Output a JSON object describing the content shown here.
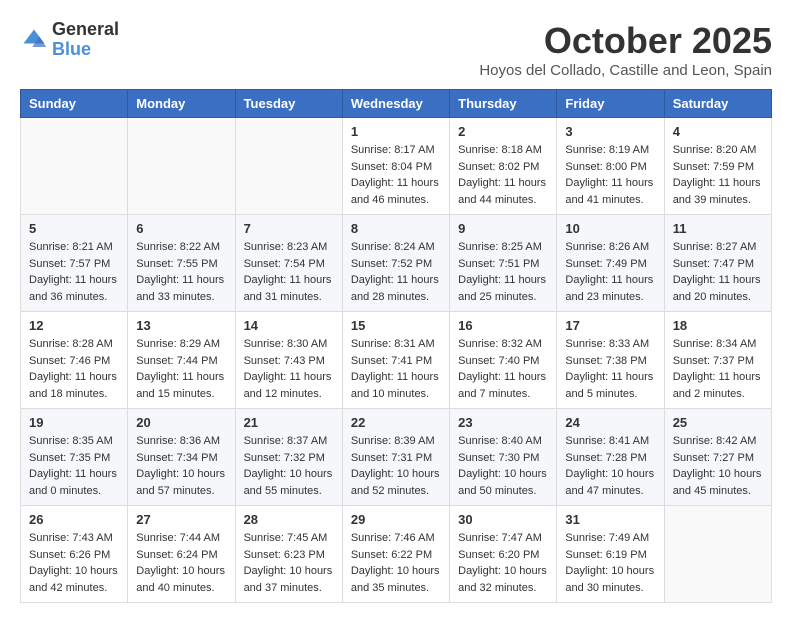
{
  "header": {
    "logo_general": "General",
    "logo_blue": "Blue",
    "month_title": "October 2025",
    "location": "Hoyos del Collado, Castille and Leon, Spain"
  },
  "days_of_week": [
    "Sunday",
    "Monday",
    "Tuesday",
    "Wednesday",
    "Thursday",
    "Friday",
    "Saturday"
  ],
  "weeks": [
    [
      {
        "day": "",
        "sunrise": "",
        "sunset": "",
        "daylight": ""
      },
      {
        "day": "",
        "sunrise": "",
        "sunset": "",
        "daylight": ""
      },
      {
        "day": "",
        "sunrise": "",
        "sunset": "",
        "daylight": ""
      },
      {
        "day": "1",
        "sunrise": "Sunrise: 8:17 AM",
        "sunset": "Sunset: 8:04 PM",
        "daylight": "Daylight: 11 hours and 46 minutes."
      },
      {
        "day": "2",
        "sunrise": "Sunrise: 8:18 AM",
        "sunset": "Sunset: 8:02 PM",
        "daylight": "Daylight: 11 hours and 44 minutes."
      },
      {
        "day": "3",
        "sunrise": "Sunrise: 8:19 AM",
        "sunset": "Sunset: 8:00 PM",
        "daylight": "Daylight: 11 hours and 41 minutes."
      },
      {
        "day": "4",
        "sunrise": "Sunrise: 8:20 AM",
        "sunset": "Sunset: 7:59 PM",
        "daylight": "Daylight: 11 hours and 39 minutes."
      }
    ],
    [
      {
        "day": "5",
        "sunrise": "Sunrise: 8:21 AM",
        "sunset": "Sunset: 7:57 PM",
        "daylight": "Daylight: 11 hours and 36 minutes."
      },
      {
        "day": "6",
        "sunrise": "Sunrise: 8:22 AM",
        "sunset": "Sunset: 7:55 PM",
        "daylight": "Daylight: 11 hours and 33 minutes."
      },
      {
        "day": "7",
        "sunrise": "Sunrise: 8:23 AM",
        "sunset": "Sunset: 7:54 PM",
        "daylight": "Daylight: 11 hours and 31 minutes."
      },
      {
        "day": "8",
        "sunrise": "Sunrise: 8:24 AM",
        "sunset": "Sunset: 7:52 PM",
        "daylight": "Daylight: 11 hours and 28 minutes."
      },
      {
        "day": "9",
        "sunrise": "Sunrise: 8:25 AM",
        "sunset": "Sunset: 7:51 PM",
        "daylight": "Daylight: 11 hours and 25 minutes."
      },
      {
        "day": "10",
        "sunrise": "Sunrise: 8:26 AM",
        "sunset": "Sunset: 7:49 PM",
        "daylight": "Daylight: 11 hours and 23 minutes."
      },
      {
        "day": "11",
        "sunrise": "Sunrise: 8:27 AM",
        "sunset": "Sunset: 7:47 PM",
        "daylight": "Daylight: 11 hours and 20 minutes."
      }
    ],
    [
      {
        "day": "12",
        "sunrise": "Sunrise: 8:28 AM",
        "sunset": "Sunset: 7:46 PM",
        "daylight": "Daylight: 11 hours and 18 minutes."
      },
      {
        "day": "13",
        "sunrise": "Sunrise: 8:29 AM",
        "sunset": "Sunset: 7:44 PM",
        "daylight": "Daylight: 11 hours and 15 minutes."
      },
      {
        "day": "14",
        "sunrise": "Sunrise: 8:30 AM",
        "sunset": "Sunset: 7:43 PM",
        "daylight": "Daylight: 11 hours and 12 minutes."
      },
      {
        "day": "15",
        "sunrise": "Sunrise: 8:31 AM",
        "sunset": "Sunset: 7:41 PM",
        "daylight": "Daylight: 11 hours and 10 minutes."
      },
      {
        "day": "16",
        "sunrise": "Sunrise: 8:32 AM",
        "sunset": "Sunset: 7:40 PM",
        "daylight": "Daylight: 11 hours and 7 minutes."
      },
      {
        "day": "17",
        "sunrise": "Sunrise: 8:33 AM",
        "sunset": "Sunset: 7:38 PM",
        "daylight": "Daylight: 11 hours and 5 minutes."
      },
      {
        "day": "18",
        "sunrise": "Sunrise: 8:34 AM",
        "sunset": "Sunset: 7:37 PM",
        "daylight": "Daylight: 11 hours and 2 minutes."
      }
    ],
    [
      {
        "day": "19",
        "sunrise": "Sunrise: 8:35 AM",
        "sunset": "Sunset: 7:35 PM",
        "daylight": "Daylight: 11 hours and 0 minutes."
      },
      {
        "day": "20",
        "sunrise": "Sunrise: 8:36 AM",
        "sunset": "Sunset: 7:34 PM",
        "daylight": "Daylight: 10 hours and 57 minutes."
      },
      {
        "day": "21",
        "sunrise": "Sunrise: 8:37 AM",
        "sunset": "Sunset: 7:32 PM",
        "daylight": "Daylight: 10 hours and 55 minutes."
      },
      {
        "day": "22",
        "sunrise": "Sunrise: 8:39 AM",
        "sunset": "Sunset: 7:31 PM",
        "daylight": "Daylight: 10 hours and 52 minutes."
      },
      {
        "day": "23",
        "sunrise": "Sunrise: 8:40 AM",
        "sunset": "Sunset: 7:30 PM",
        "daylight": "Daylight: 10 hours and 50 minutes."
      },
      {
        "day": "24",
        "sunrise": "Sunrise: 8:41 AM",
        "sunset": "Sunset: 7:28 PM",
        "daylight": "Daylight: 10 hours and 47 minutes."
      },
      {
        "day": "25",
        "sunrise": "Sunrise: 8:42 AM",
        "sunset": "Sunset: 7:27 PM",
        "daylight": "Daylight: 10 hours and 45 minutes."
      }
    ],
    [
      {
        "day": "26",
        "sunrise": "Sunrise: 7:43 AM",
        "sunset": "Sunset: 6:26 PM",
        "daylight": "Daylight: 10 hours and 42 minutes."
      },
      {
        "day": "27",
        "sunrise": "Sunrise: 7:44 AM",
        "sunset": "Sunset: 6:24 PM",
        "daylight": "Daylight: 10 hours and 40 minutes."
      },
      {
        "day": "28",
        "sunrise": "Sunrise: 7:45 AM",
        "sunset": "Sunset: 6:23 PM",
        "daylight": "Daylight: 10 hours and 37 minutes."
      },
      {
        "day": "29",
        "sunrise": "Sunrise: 7:46 AM",
        "sunset": "Sunset: 6:22 PM",
        "daylight": "Daylight: 10 hours and 35 minutes."
      },
      {
        "day": "30",
        "sunrise": "Sunrise: 7:47 AM",
        "sunset": "Sunset: 6:20 PM",
        "daylight": "Daylight: 10 hours and 32 minutes."
      },
      {
        "day": "31",
        "sunrise": "Sunrise: 7:49 AM",
        "sunset": "Sunset: 6:19 PM",
        "daylight": "Daylight: 10 hours and 30 minutes."
      },
      {
        "day": "",
        "sunrise": "",
        "sunset": "",
        "daylight": ""
      }
    ]
  ]
}
